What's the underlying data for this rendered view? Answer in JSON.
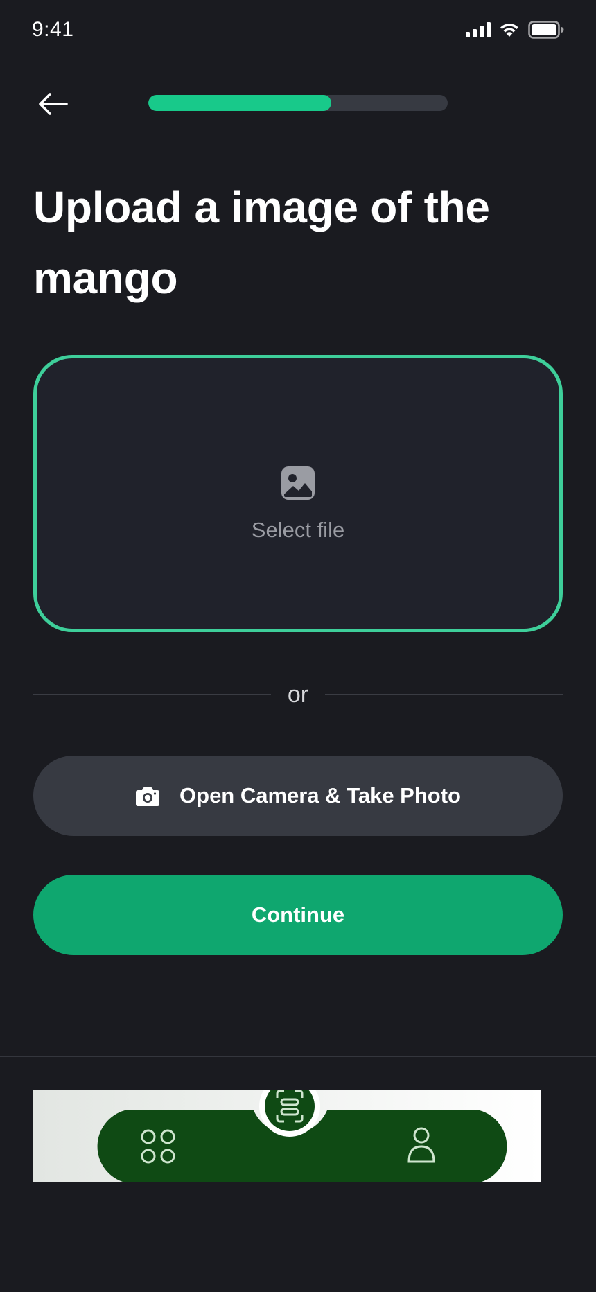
{
  "status_bar": {
    "time": "9:41",
    "icons": [
      "cellular-signal-icon",
      "wifi-icon",
      "battery-icon"
    ]
  },
  "header": {
    "back_icon": "arrow-left-icon",
    "progress_fraction": 0.61
  },
  "page": {
    "title": "Upload a image of the mango"
  },
  "upload": {
    "icon": "image-icon",
    "label": "Select file"
  },
  "divider": {
    "label": "or"
  },
  "camera_button": {
    "icon": "camera-icon",
    "label": "Open Camera & Take Photo"
  },
  "continue_button": {
    "label": "Continue"
  },
  "bottom_nav": {
    "icons": [
      "grid-icon",
      "scan-icon",
      "user-icon"
    ]
  },
  "colors": {
    "background": "#1a1b20",
    "accent": "#18c98a",
    "upload_border": "#3ecf9a",
    "continue_bg": "#0fa76f",
    "secondary_button_bg": "#373a42",
    "nav_green": "#0f4a14"
  }
}
